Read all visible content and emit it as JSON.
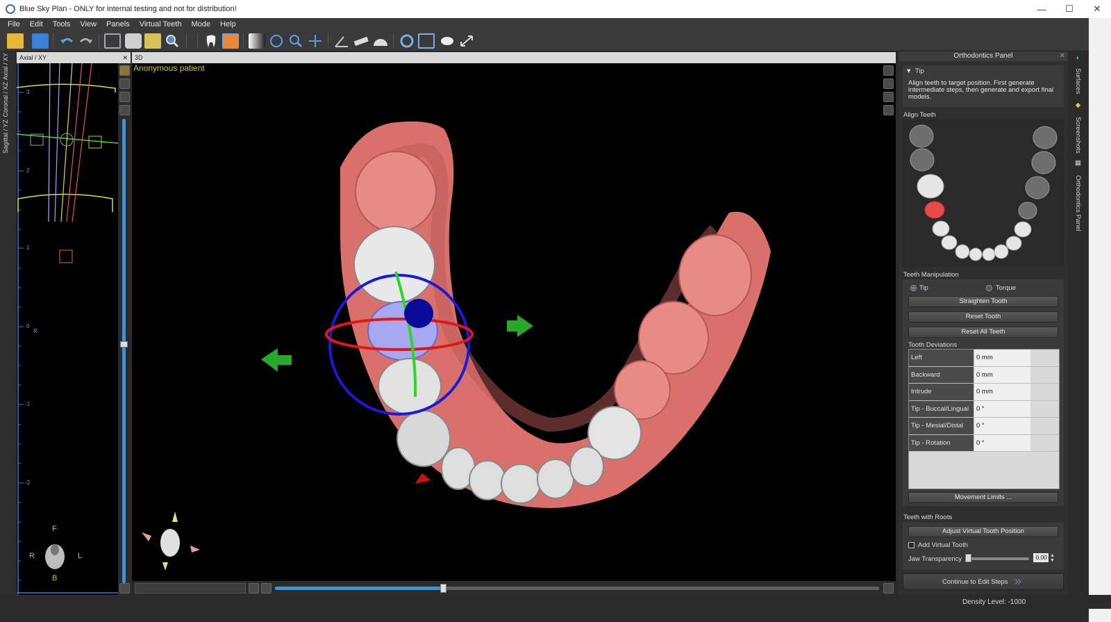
{
  "window": {
    "title": "Blue Sky Plan - ONLY for internal testing and not for distribution!",
    "minimize": "—",
    "maximize": "☐",
    "close": "✕"
  },
  "menu": [
    "File",
    "Edit",
    "Tools",
    "View",
    "Panels",
    "Virtual Teeth",
    "Mode",
    "Help"
  ],
  "toolbar": {
    "icons": [
      "open-icon",
      "save-icon",
      "undo-icon",
      "redo-icon",
      "layout-icon",
      "screenshot-icon",
      "measure-grid-icon",
      "magnifier-icon",
      "tooth-icon",
      "teeth-color-icon",
      "contrast-icon",
      "rotate-icon",
      "zoom-icon",
      "pan-icon",
      "angle-icon",
      "ruler-icon",
      "protractor-icon",
      "reset-view-icon",
      "align-icon",
      "cloud-icon",
      "fullscreen-icon"
    ]
  },
  "left_tabs": [
    "Axial / XY",
    "Coronal / XZ",
    "Sagittal / YZ"
  ],
  "left_view": {
    "header": "Axial / XY",
    "ruler_labels": [
      "3",
      "2",
      "1",
      "0",
      "R",
      "-1",
      "-2"
    ],
    "orient": {
      "f": "F",
      "r": "R",
      "l": "L",
      "b": "B"
    }
  },
  "view3d": {
    "header": "3D",
    "patient": "Anonymous patient"
  },
  "orthodontics_panel": {
    "title": "Orthodontics Panel",
    "close": "✕",
    "tip_header": "Tip",
    "tip_text": "Align teeth to target position. First generate intermediate steps, then generate and export final models.",
    "align_teeth": "Align Teeth",
    "teeth_manipulation": "Teeth Manipulation",
    "radio_tip": "Tip",
    "radio_torque": "Torque",
    "straighten": "Straighten Tooth",
    "reset_tooth": "Reset Tooth",
    "reset_all": "Reset All Teeth",
    "tooth_deviations": "Tooth Deviations",
    "deviations": [
      {
        "k": "Left",
        "v": "0 mm"
      },
      {
        "k": "Backward",
        "v": "0 mm"
      },
      {
        "k": "Intrude",
        "v": "0 mm"
      },
      {
        "k": "Tip - Buccal/Lingual",
        "v": "0 °"
      },
      {
        "k": "Tip - Mesial/Distal",
        "v": "0 °"
      },
      {
        "k": "Tip - Rotation",
        "v": "0 °"
      }
    ],
    "movement_limits": "Movement Limits ...",
    "teeth_with_roots": "Teeth with Roots",
    "adjust_virtual": "Adjust Virtual Tooth Position",
    "add_virtual": "Add Virtual Tooth",
    "jaw_transparency": "Jaw Transparency",
    "jaw_value": "0.00",
    "continue": "Continue to Edit Steps"
  },
  "side_tabs": [
    "Surfaces",
    "Screenshots",
    "Orthodontics Panel"
  ],
  "status": {
    "density": "Density Level: -1000"
  },
  "colors": {
    "accent": "#4a90c8",
    "gum": "#d9706c",
    "selected_tooth": "#9aa0ee",
    "patient_label": "#d4c21a"
  }
}
